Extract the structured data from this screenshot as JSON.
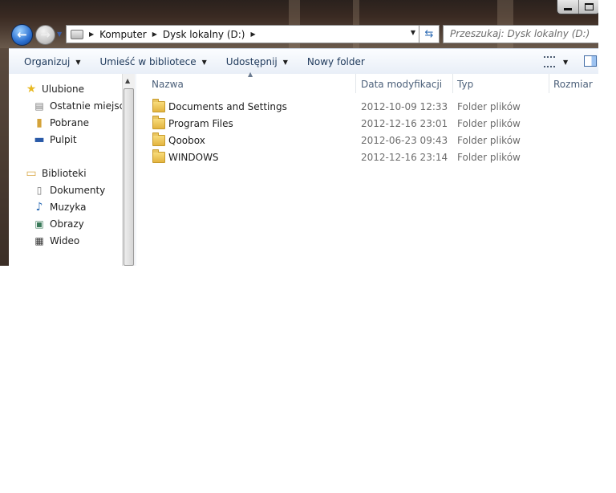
{
  "window": {
    "address": {
      "crumbs": [
        "Komputer",
        "Dysk lokalny (D:)"
      ]
    },
    "search": {
      "placeholder": "Przeszukaj: Dysk lokalny (D:)"
    }
  },
  "toolbar": {
    "organize": "Organizuj",
    "include_library": "Umieść w bibliotece",
    "share": "Udostępnij",
    "new_folder": "Nowy folder"
  },
  "navpane": {
    "favorites": {
      "label": "Ulubione",
      "items": [
        "Ostatnie miejsca",
        "Pobrane",
        "Pulpit"
      ]
    },
    "libraries": {
      "label": "Biblioteki",
      "items": [
        "Dokumenty",
        "Muzyka",
        "Obrazy",
        "Wideo"
      ]
    }
  },
  "filelist": {
    "columns": [
      "Nazwa",
      "Data modyfikacji",
      "Typ",
      "Rozmiar"
    ],
    "rows": [
      {
        "name": "Documents and Settings",
        "date": "2012-10-09 12:33",
        "type": "Folder plików"
      },
      {
        "name": "Program Files",
        "date": "2012-12-16 23:01",
        "type": "Folder plików"
      },
      {
        "name": "Qoobox",
        "date": "2012-06-23 09:43",
        "type": "Folder plików"
      },
      {
        "name": "WINDOWS",
        "date": "2012-12-16 23:14",
        "type": "Folder plików"
      }
    ]
  },
  "icons": {
    "back": "back-arrow-icon",
    "forward": "forward-arrow-icon",
    "favorites": "star-icon",
    "libraries": "library-icon",
    "folder": "folder-icon"
  },
  "colors": {
    "accent_text": "#1e395b",
    "header_text": "#4c607a",
    "secondary_text": "#6d6d6d",
    "folder": "#e3b440"
  }
}
